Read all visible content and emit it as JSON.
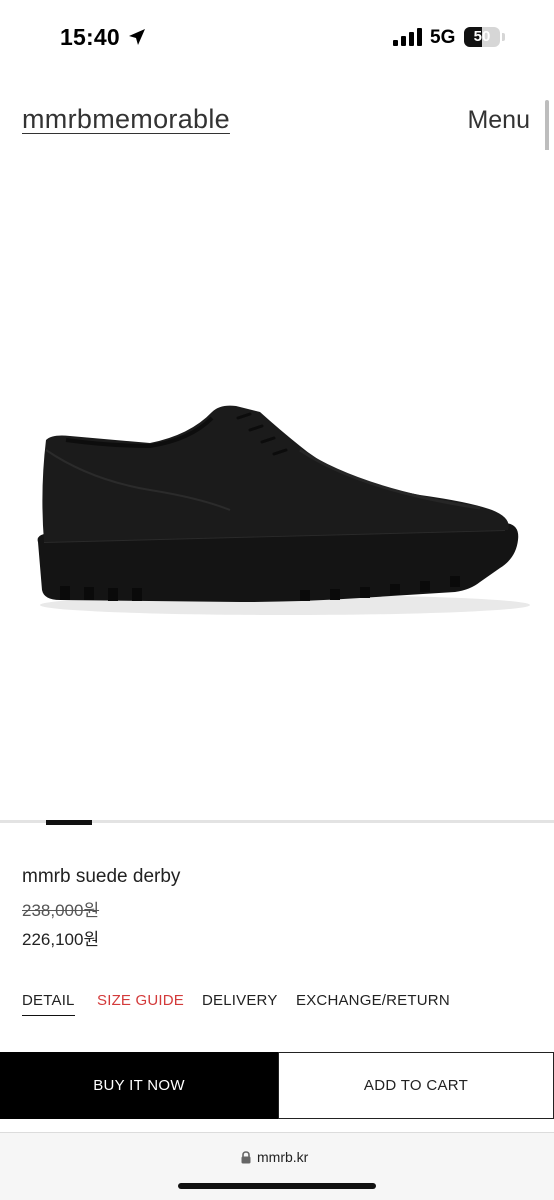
{
  "status": {
    "time": "15:40",
    "network": "5G",
    "battery": "50",
    "battery_level": 0.5
  },
  "header": {
    "logo": "mmrbmemorable",
    "menu": "Menu"
  },
  "product": {
    "image_alt_icon": "suede-derby-shoe-image",
    "name": "mmrb suede derby",
    "original_price": "238,000원",
    "sale_price": "226,100원"
  },
  "tabs": [
    {
      "label": "DETAIL"
    },
    {
      "label": "SIZE GUIDE"
    },
    {
      "label": "DELIVERY"
    },
    {
      "label": "EXCHANGE/RETURN"
    }
  ],
  "actions": {
    "buy_now": "BUY IT NOW",
    "add_to_cart": "ADD TO CART"
  },
  "browser": {
    "url": "mmrb.kr"
  },
  "colors": {
    "accent": "#d33a3a",
    "primary": "#000000"
  }
}
